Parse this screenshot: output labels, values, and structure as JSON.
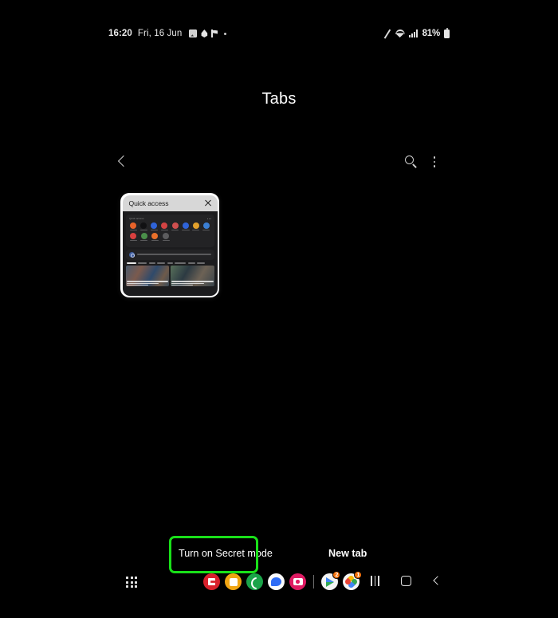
{
  "status_bar": {
    "time": "16:20",
    "date": "Fri, 16 Jun",
    "left_icons": [
      "gallery-icon",
      "drop-icon",
      "flag-icon",
      "dot-indicator"
    ],
    "right_icons": [
      "slash-icon",
      "wifi-icon",
      "signal-icon"
    ],
    "battery_percent": "81%",
    "battery_icon": "battery-icon"
  },
  "header": {
    "title": "Tabs"
  },
  "toolbar": {
    "back_icon": "chevron-left-icon",
    "search_icon": "search-icon",
    "more_icon": "more-vertical-icon"
  },
  "tab_card": {
    "title": "Quick access",
    "close_icon": "close-icon",
    "preview": {
      "section_label": "Quick access",
      "shortcut_rows": [
        [
          {
            "name": "shortcut-1",
            "color": "#e8632a"
          },
          {
            "name": "shortcut-2",
            "color": "#1e1e20"
          },
          {
            "name": "shortcut-3",
            "color": "#2f63d8"
          },
          {
            "name": "shortcut-4",
            "color": "#d24343"
          },
          {
            "name": "shortcut-5",
            "color": "#cf4f4f"
          },
          {
            "name": "shortcut-6",
            "color": "#2f63d8"
          },
          {
            "name": "shortcut-7",
            "color": "#e2a12c"
          },
          {
            "name": "shortcut-8",
            "color": "#3b7fd4"
          }
        ],
        [
          {
            "name": "shortcut-9",
            "color": "#d9403f"
          },
          {
            "name": "shortcut-10",
            "color": "#4a8f4a"
          },
          {
            "name": "shortcut-11",
            "color": "#e8702a"
          },
          {
            "name": "shortcut-12",
            "color": "#787878"
          }
        ]
      ],
      "search_row": {
        "icon": "search-bubble-icon"
      },
      "category_tabs": [
        "For you",
        "Top news",
        "Latest",
        "Politics",
        "Tech",
        "Entertainment",
        "Sports",
        "Business"
      ],
      "news_cards": [
        {
          "name": "news-card-1"
        },
        {
          "name": "news-card-2"
        }
      ]
    }
  },
  "bottom_bar": {
    "secret_mode_label": "Turn on Secret mode",
    "new_tab_label": "New tab",
    "highlight_color": "#19e019"
  },
  "taskbar": {
    "apps_icon": "apps-grid-icon",
    "apps": [
      {
        "name": "app-icon-red",
        "class": "ai-red",
        "badge": ""
      },
      {
        "name": "app-icon-orange",
        "class": "ai-orange",
        "badge": ""
      },
      {
        "name": "phone-icon",
        "class": "ai-green",
        "badge": ""
      },
      {
        "name": "messages-icon",
        "class": "ai-white",
        "badge": ""
      },
      {
        "name": "camera-icon",
        "class": "ai-pink",
        "badge": ""
      }
    ],
    "recent_apps": [
      {
        "name": "play-store-icon",
        "badge": "2"
      },
      {
        "name": "google-photos-icon",
        "badge": "1"
      }
    ],
    "nav": {
      "recents_icon": "recents-icon",
      "home_icon": "home-icon",
      "back_icon": "back-icon"
    }
  }
}
